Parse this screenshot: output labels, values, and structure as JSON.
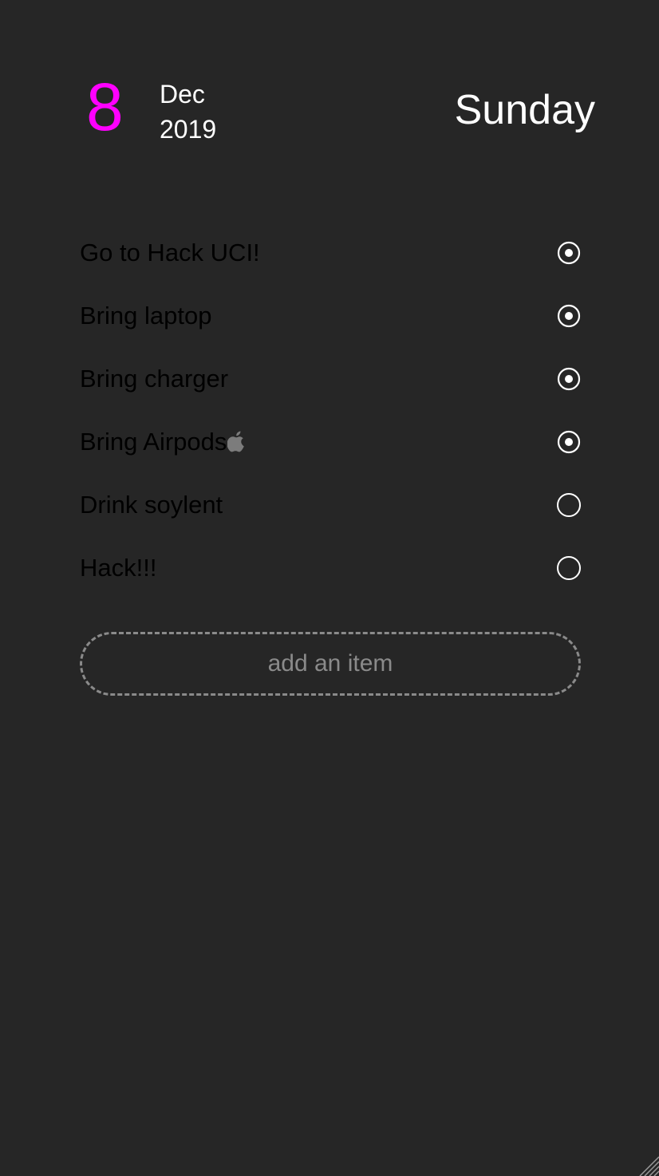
{
  "header": {
    "day": "8",
    "month": "Dec",
    "year": "2019",
    "weekday": "Sunday"
  },
  "todos": [
    {
      "text": "Go to Hack UCI!",
      "done": true
    },
    {
      "text": "Bring laptop",
      "done": true
    },
    {
      "text": "Bring charger",
      "done": true
    },
    {
      "text": "Bring Airpods",
      "done": true,
      "icon": "apple-icon"
    },
    {
      "text": "Drink soylent",
      "done": false
    },
    {
      "text": "Hack!!!",
      "done": false
    }
  ],
  "add_item": {
    "label": "add an item"
  },
  "colors": {
    "background": "#262626",
    "accent": "#ff00ff",
    "done_text": "#7c7c7c",
    "open_text": "#ffffff",
    "dashed_border": "#8a8a8a"
  }
}
